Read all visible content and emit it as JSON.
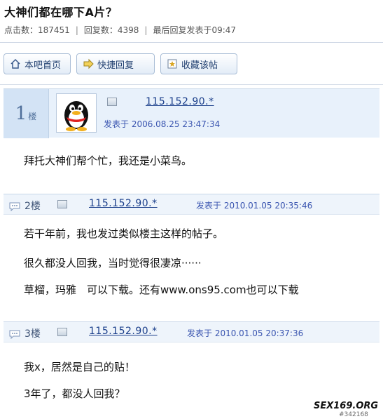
{
  "thread": {
    "title": "大神们都在哪下A片？",
    "stats": {
      "clicks": "点击数：187451",
      "replies": "回复数：4398",
      "last_reply": "最后回复发表于09:47"
    }
  },
  "toolbar": {
    "home_label": "本吧首页",
    "quick_reply_label": "快捷回复",
    "favorite_label": "收藏该帖"
  },
  "posts": [
    {
      "floor_num": "1",
      "floor_unit": "楼",
      "ip": "115.152.90.*",
      "posted": "发表于 2006.08.25 23:47:34",
      "lines": [
        "拜托大神们帮个忙，我还是小菜鸟。"
      ]
    },
    {
      "floor": "2楼",
      "ip": "115.152.90.*",
      "posted": "发表于 2010.01.05 20:35:46",
      "lines": [
        "若干年前，我也发过类似楼主这样的帖子。",
        "很久都没人回我，当时觉得很凄凉······",
        "草榴，玛雅　可以下载。还有www.ons95.com也可以下载"
      ]
    },
    {
      "floor": "3楼",
      "ip": "115.152.90.*",
      "posted": "发表于 2010.01.05 20:37:36",
      "lines": [
        "我x，居然是自己的贴！",
        "3年了，都没人回我？"
      ]
    }
  ],
  "watermark": {
    "site": "SEX169.ORG",
    "id": "#342168"
  },
  "colors": {
    "link": "#1b3f8b",
    "posted": "#3a55b0",
    "header_bg": "#e8f1fb"
  }
}
